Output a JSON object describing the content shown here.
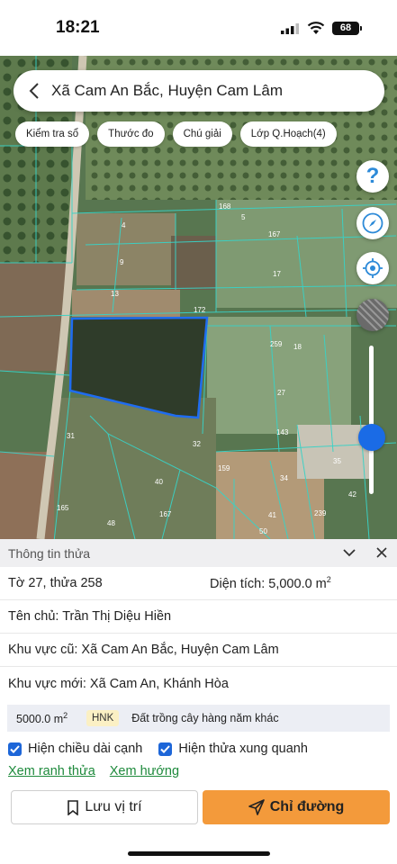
{
  "status": {
    "time": "18:21",
    "battery": "68"
  },
  "search": {
    "text": "Xã Cam An Bắc, Huyện Cam Lâm"
  },
  "chips": [
    "Kiểm tra sổ",
    "Thước đo",
    "Chú giải",
    "Lớp Q.Hoạch(4)"
  ],
  "map_buttons": {
    "help": "?"
  },
  "map_labels": [
    "168",
    "5",
    "167",
    "4",
    "9",
    "17",
    "13",
    "172",
    "259",
    "18",
    "27",
    "31",
    "143",
    "32",
    "35",
    "159",
    "40",
    "34",
    "42",
    "165",
    "167",
    "41",
    "239",
    "48",
    "50"
  ],
  "panel": {
    "title": "Thông tin thửa",
    "sheet_parcel": "Tờ 27, thửa 258",
    "area_label": "Diện tích: 5,000.0 m",
    "area_sup": "2",
    "owner": "Tên chủ: Trần Thị Diệu Hiền",
    "old_area": "Khu vực cũ: Xã Cam An Bắc, Huyện Cam Lâm",
    "new_area": "Khu vực mới: Xã Cam An, Khánh Hòa",
    "land": {
      "area": "5000.0 m",
      "area_sup": "2",
      "code": "HNK",
      "type": "Đất trồng cây hàng năm khác"
    },
    "check_edge": "Hiện chiều dài cạnh",
    "check_neighbors": "Hiện thửa xung quanh",
    "link_boundary": "Xem ranh thửa",
    "link_direction": "Xem hướng",
    "save_btn": "Lưu vị trí",
    "direction_btn": "Chỉ đường"
  },
  "colors": {
    "accent_orange": "#f39a3b",
    "link_green": "#1e8a3c",
    "checkbox_blue": "#1d66d8",
    "parcel_blue": "#1f6cf0"
  }
}
